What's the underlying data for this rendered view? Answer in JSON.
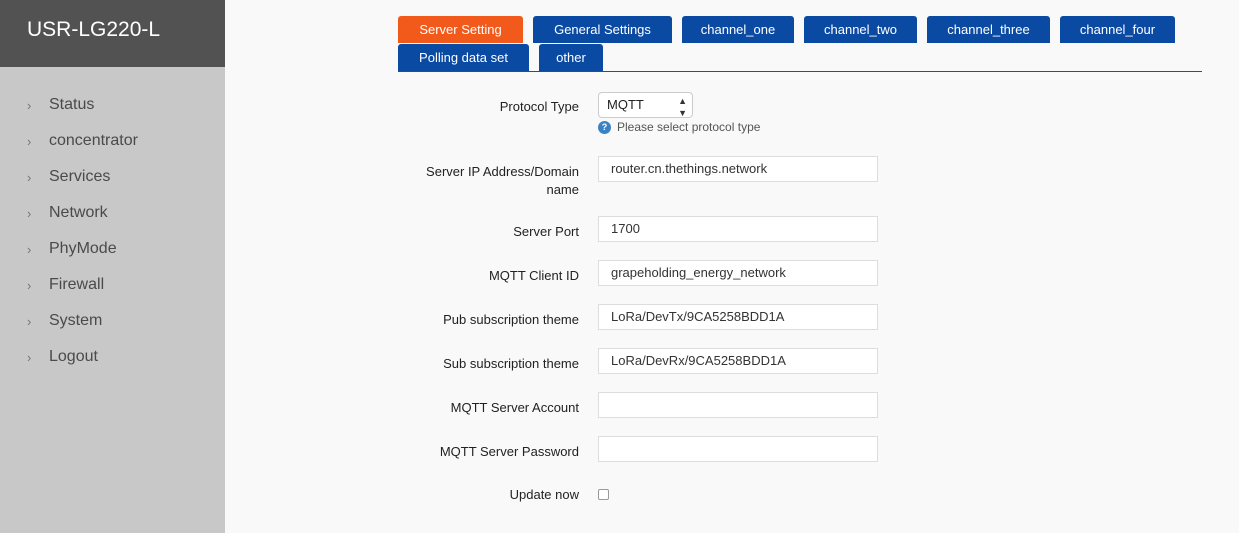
{
  "app": {
    "title": "USR-LG220-L"
  },
  "sidebar": {
    "items": [
      {
        "label": "Status"
      },
      {
        "label": "concentrator"
      },
      {
        "label": "Services"
      },
      {
        "label": "Network"
      },
      {
        "label": "PhyMode"
      },
      {
        "label": "Firewall"
      },
      {
        "label": "System"
      },
      {
        "label": "Logout"
      }
    ]
  },
  "tabs": [
    {
      "label": "Server Setting",
      "active": true
    },
    {
      "label": "General Settings"
    },
    {
      "label": "channel_one"
    },
    {
      "label": "channel_two"
    },
    {
      "label": "channel_three"
    },
    {
      "label": "channel_four"
    },
    {
      "label": "Polling data set"
    },
    {
      "label": "other"
    }
  ],
  "colors": {
    "active_tab": "#f25a1b",
    "tab": "#0b4aa3",
    "sidebar": "#c8c8c8",
    "brand": "#525252"
  },
  "form": {
    "protocol_type": {
      "label": "Protocol Type",
      "value": "MQTT",
      "hint": "Please select protocol type"
    },
    "server_ip": {
      "label_line1": "Server IP Address/Domain",
      "label_line2": "name",
      "value": "router.cn.thethings.network"
    },
    "server_port": {
      "label": "Server Port",
      "value": "1700"
    },
    "client_id": {
      "label": "MQTT Client ID",
      "value": "grapeholding_energy_network"
    },
    "pub_theme": {
      "label": "Pub subscription theme",
      "value": "LoRa/DevTx/9CA5258BDD1A"
    },
    "sub_theme": {
      "label": "Sub subscription theme",
      "value": "LoRa/DevRx/9CA5258BDD1A"
    },
    "account": {
      "label": "MQTT Server Account",
      "value": ""
    },
    "password": {
      "label": "MQTT Server Password",
      "value": ""
    },
    "update_now": {
      "label": "Update now",
      "checked": false
    }
  }
}
